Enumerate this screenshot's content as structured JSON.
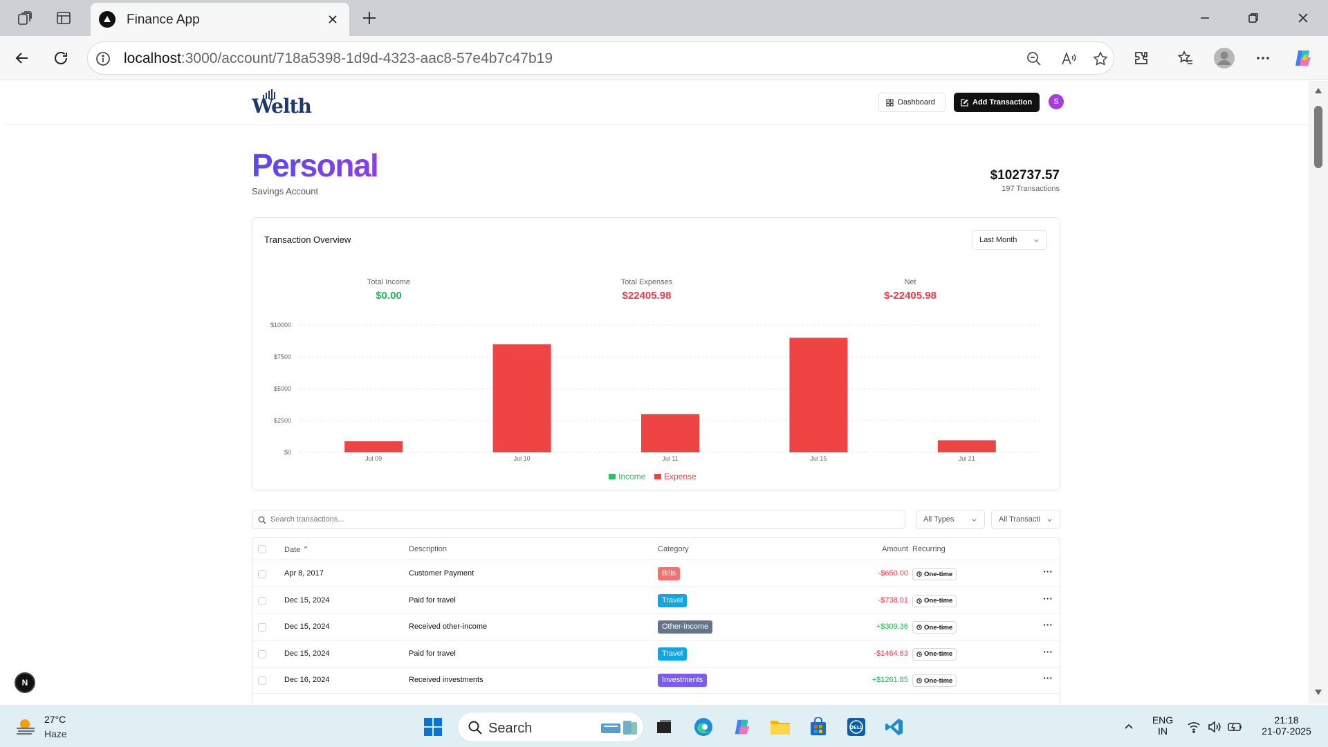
{
  "browser": {
    "tab_title": "Finance App",
    "url_host": "localhost",
    "url_path": ":3000/account/718a5398-1d9d-4323-aac8-57e4b7c47b19"
  },
  "app": {
    "logo": "Welth",
    "nav": {
      "dashboard": "Dashboard",
      "add_transaction": "Add Transaction"
    },
    "avatar_initial": "S"
  },
  "account": {
    "name": "Personal",
    "type": "Savings Account",
    "balance": "$102737.57",
    "transactions_count": "197 Transactions"
  },
  "overview": {
    "title": "Transaction Overview",
    "period": "Last Month",
    "total_income_label": "Total Income",
    "total_income": "$0.00",
    "total_expenses_label": "Total Expenses",
    "total_expenses": "$22405.98",
    "net_label": "Net",
    "net": "$-22405.98"
  },
  "chart_data": {
    "type": "bar",
    "categories": [
      "Jul 09",
      "Jul 10",
      "Jul 11",
      "Jul 15",
      "Jul 21"
    ],
    "series": [
      {
        "name": "Income",
        "color": "#22c55e",
        "values": [
          0,
          0,
          0,
          0,
          0
        ]
      },
      {
        "name": "Expense",
        "color": "#ef4444",
        "values": [
          870,
          8500,
          3000,
          9000,
          950
        ]
      }
    ],
    "y_ticks": [
      "$10000",
      "$7500",
      "$5000",
      "$2500",
      "$0"
    ],
    "ylim": [
      0,
      10000
    ],
    "grid": true,
    "legend_position": "bottom-center"
  },
  "filters": {
    "search_placeholder": "Search transactions...",
    "type": "All Types",
    "transactions": "All Transacti"
  },
  "table": {
    "headers": {
      "date": "Date",
      "description": "Description",
      "category": "Category",
      "amount": "Amount",
      "recurring": "Recurring"
    },
    "rows": [
      {
        "date": "Apr 8, 2017",
        "description": "Customer Payment",
        "category": "Bills",
        "category_color": "#f87171",
        "amount": "-$650.00",
        "amount_type": "expense",
        "recurring": "One-time"
      },
      {
        "date": "Dec 15, 2024",
        "description": "Paid for travel",
        "category": "Travel",
        "category_color": "#0ea5e9",
        "amount": "-$738.01",
        "amount_type": "expense",
        "recurring": "One-time"
      },
      {
        "date": "Dec 15, 2024",
        "description": "Received other-income",
        "category": "Other-Income",
        "category_color": "#64748b",
        "amount": "+$309.36",
        "amount_type": "income",
        "recurring": "One-time"
      },
      {
        "date": "Dec 15, 2024",
        "description": "Paid for travel",
        "category": "Travel",
        "category_color": "#0ea5e9",
        "amount": "-$1464.63",
        "amount_type": "expense",
        "recurring": "One-time"
      },
      {
        "date": "Dec 16, 2024",
        "description": "Received investments",
        "category": "Investments",
        "category_color": "#7c5cf0",
        "amount": "+$1261.85",
        "amount_type": "income",
        "recurring": "One-time"
      }
    ]
  },
  "taskbar": {
    "temperature": "27°C",
    "condition": "Haze",
    "search": "Search",
    "lang_top": "ENG",
    "lang_bottom": "IN",
    "time": "21:18",
    "date": "21-07-2025"
  },
  "dev_badge": "N"
}
